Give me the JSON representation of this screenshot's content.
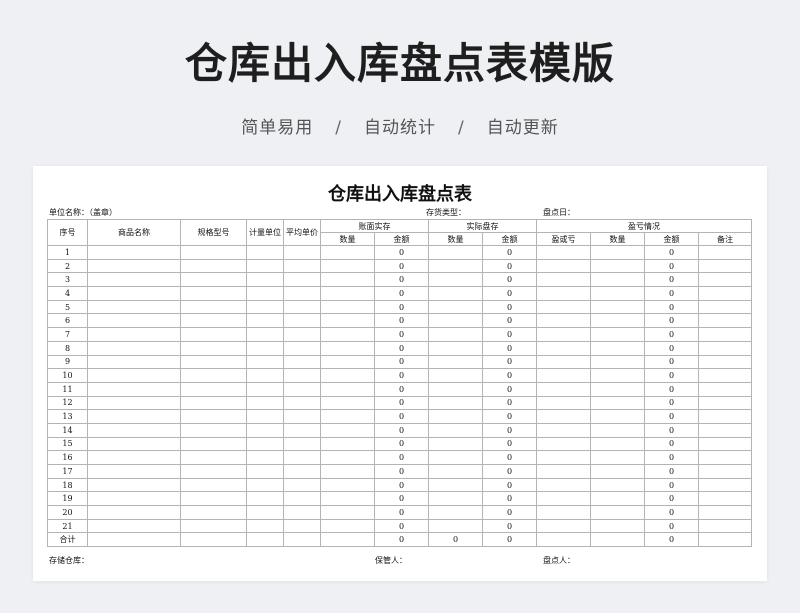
{
  "header": {
    "title": "仓库出入库盘点表模版",
    "features": [
      "简单易用",
      "自动统计",
      "自动更新"
    ],
    "separator": "/"
  },
  "document": {
    "title": "仓库出入库盘点表",
    "unit_label": "单位名称：（盖章）",
    "inventory_type_label": "存货类型：",
    "date_label": "盘点日：",
    "columns": {
      "seq": "序号",
      "name": "商品名称",
      "spec": "规格型号",
      "unit": "计量单位",
      "avg_price": "平均单价",
      "book_group": "账面实存",
      "actual_group": "实际盘存",
      "diff_group": "盈亏情况",
      "qty": "数量",
      "amount": "金额",
      "gain_loss": "盈或亏",
      "remark": "备注"
    },
    "rows": [
      {
        "seq": "1",
        "book_amount": "0",
        "actual_amount": "0",
        "diff_amount": "0"
      },
      {
        "seq": "2",
        "book_amount": "0",
        "actual_amount": "0",
        "diff_amount": "0"
      },
      {
        "seq": "3",
        "book_amount": "0",
        "actual_amount": "0",
        "diff_amount": "0"
      },
      {
        "seq": "4",
        "book_amount": "0",
        "actual_amount": "0",
        "diff_amount": "0"
      },
      {
        "seq": "5",
        "book_amount": "0",
        "actual_amount": "0",
        "diff_amount": "0"
      },
      {
        "seq": "6",
        "book_amount": "0",
        "actual_amount": "0",
        "diff_amount": "0"
      },
      {
        "seq": "7",
        "book_amount": "0",
        "actual_amount": "0",
        "diff_amount": "0"
      },
      {
        "seq": "8",
        "book_amount": "0",
        "actual_amount": "0",
        "diff_amount": "0"
      },
      {
        "seq": "9",
        "book_amount": "0",
        "actual_amount": "0",
        "diff_amount": "0"
      },
      {
        "seq": "10",
        "book_amount": "0",
        "actual_amount": "0",
        "diff_amount": "0"
      },
      {
        "seq": "11",
        "book_amount": "0",
        "actual_amount": "0",
        "diff_amount": "0"
      },
      {
        "seq": "12",
        "book_amount": "0",
        "actual_amount": "0",
        "diff_amount": "0"
      },
      {
        "seq": "13",
        "book_amount": "0",
        "actual_amount": "0",
        "diff_amount": "0"
      },
      {
        "seq": "14",
        "book_amount": "0",
        "actual_amount": "0",
        "diff_amount": "0"
      },
      {
        "seq": "15",
        "book_amount": "0",
        "actual_amount": "0",
        "diff_amount": "0"
      },
      {
        "seq": "16",
        "book_amount": "0",
        "actual_amount": "0",
        "diff_amount": "0"
      },
      {
        "seq": "17",
        "book_amount": "0",
        "actual_amount": "0",
        "diff_amount": "0"
      },
      {
        "seq": "18",
        "book_amount": "0",
        "actual_amount": "0",
        "diff_amount": "0"
      },
      {
        "seq": "19",
        "book_amount": "0",
        "actual_amount": "0",
        "diff_amount": "0"
      },
      {
        "seq": "20",
        "book_amount": "0",
        "actual_amount": "0",
        "diff_amount": "0"
      },
      {
        "seq": "21",
        "book_amount": "0",
        "actual_amount": "0",
        "diff_amount": "0"
      }
    ],
    "total": {
      "label": "合计",
      "book_amount": "0",
      "actual_qty": "0",
      "actual_amount": "0",
      "diff_amount": "0"
    },
    "footer": {
      "warehouse_label": "存储仓库：",
      "keeper_label": "保管人：",
      "counter_label": "盘点人："
    }
  }
}
